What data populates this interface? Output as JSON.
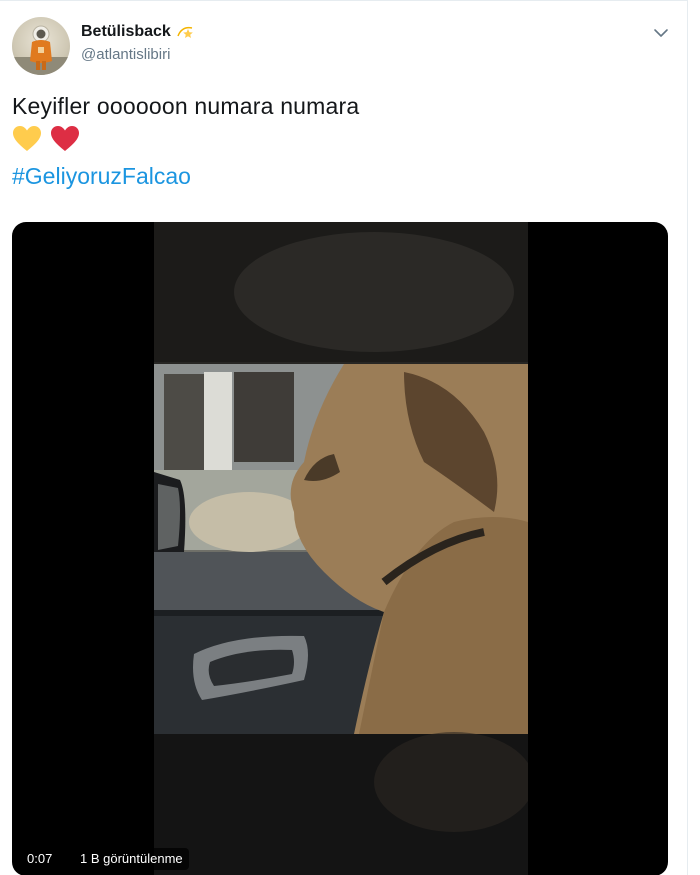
{
  "author": {
    "display_name": "Betülisback",
    "name_emoji": "dizzy-star-emoji",
    "handle": "@atlantislibiri",
    "avatar": "astronaut-avatar"
  },
  "tweet": {
    "text": "Keyifler oooooon numara numara",
    "emojis": [
      "yellow-heart",
      "red-heart"
    ],
    "hashtag": "#GeliyoruzFalcao"
  },
  "media": {
    "type": "video",
    "duration": "0:07",
    "views": "1 B görüntülenme"
  },
  "colors": {
    "link": "#1b95e0",
    "text": "#14171a",
    "secondary": "#657786",
    "yellow_heart": "#ffcc4d",
    "red_heart": "#dd2e44"
  }
}
